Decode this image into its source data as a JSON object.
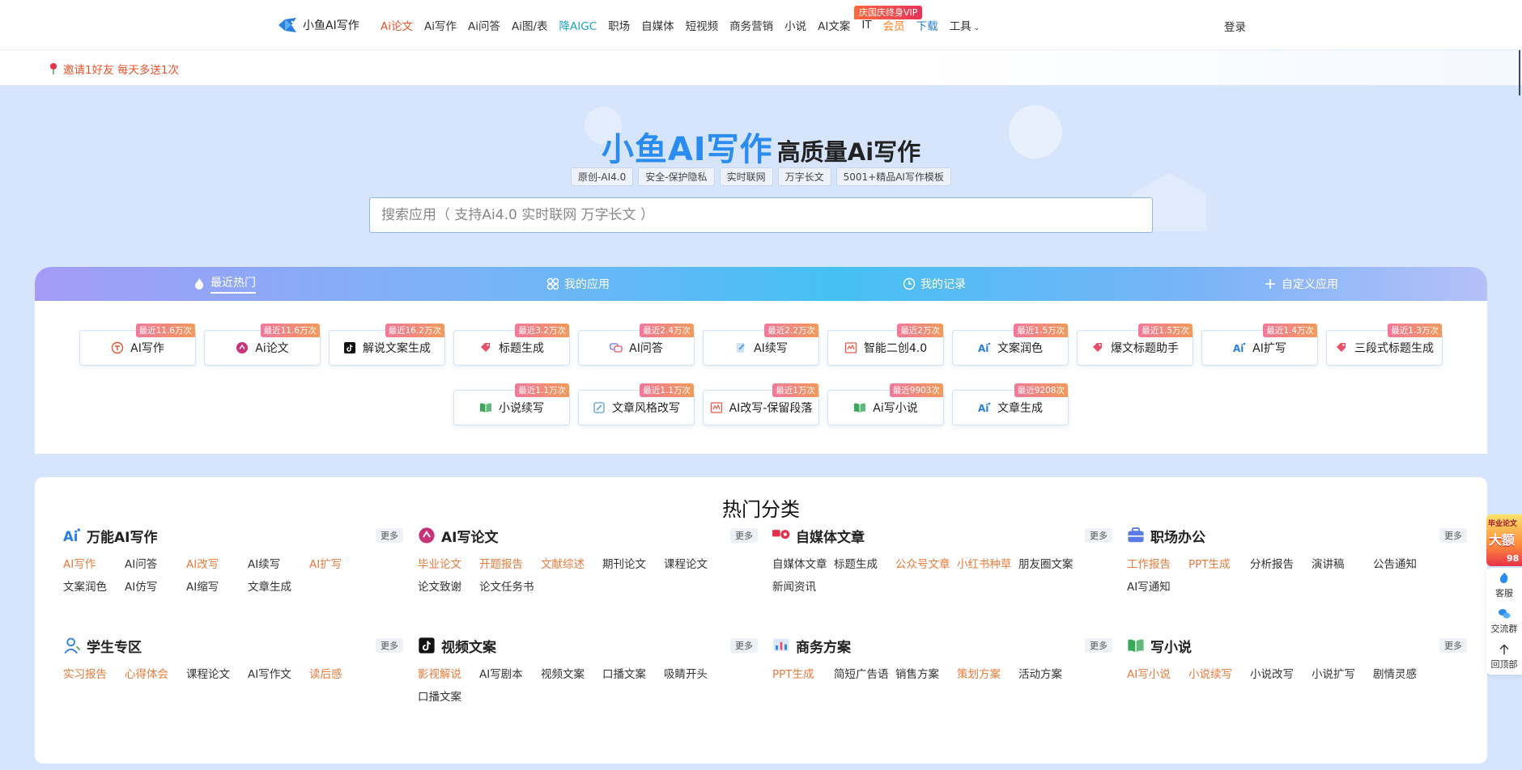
{
  "nav": {
    "brand": "小鱼AI写作",
    "items": [
      {
        "label": "Ai论文",
        "style": "active"
      },
      {
        "label": "Ai写作",
        "style": ""
      },
      {
        "label": "Ai问答",
        "style": ""
      },
      {
        "label": "Ai图/表",
        "style": ""
      },
      {
        "label": "降AIGC",
        "style": "teal"
      },
      {
        "label": "职场",
        "style": ""
      },
      {
        "label": "自媒体",
        "style": ""
      },
      {
        "label": "短视频",
        "style": ""
      },
      {
        "label": "商务营销",
        "style": ""
      },
      {
        "label": "小说",
        "style": ""
      },
      {
        "label": "AI文案",
        "style": ""
      },
      {
        "label": "IT",
        "style": ""
      },
      {
        "label": "会员",
        "style": "orange"
      },
      {
        "label": "下载",
        "style": "blue"
      },
      {
        "label": "工具",
        "style": ""
      }
    ],
    "vip_badge": "庆国庆终身VIP",
    "login": "登录"
  },
  "invite": {
    "text": "邀请1好友 每天多送1次"
  },
  "hero": {
    "brand": "小鱼AI写作",
    "subtitle": "高质量Ai写作",
    "tags": [
      "原创-AI4.0",
      "安全-保护隐私",
      "实时联网",
      "万字长文",
      "5001+精品AI写作模板"
    ],
    "search_placeholder": "搜索应用（ 支持Ai4.0 实时联网 万字长文 ）"
  },
  "tabs": [
    {
      "label": "最近热门",
      "icon": "flame-icon",
      "active": true
    },
    {
      "label": "我的应用",
      "icon": "grid-icon",
      "active": false
    },
    {
      "label": "我的记录",
      "icon": "clock-icon",
      "active": false
    },
    {
      "label": "自定义应用",
      "icon": "plus-icon",
      "active": false
    }
  ],
  "apps": [
    {
      "label": "AI写作",
      "badge": "最近11.6万次",
      "icon": "writing-icon",
      "color": "#e8532a"
    },
    {
      "label": "Ai论文",
      "badge": "最近11.6万次",
      "icon": "paper-icon",
      "color": "#c8327a"
    },
    {
      "label": "解说文案生成",
      "badge": "最近16.2万次",
      "icon": "tiktok-icon",
      "color": "#111111"
    },
    {
      "label": "标题生成",
      "badge": "最近3.2万次",
      "icon": "tag-icon",
      "color": "#e8506a"
    },
    {
      "label": "AI问答",
      "badge": "最近2.4万次",
      "icon": "qa-icon",
      "color": "#7a6af0"
    },
    {
      "label": "AI续写",
      "badge": "最近2.2万次",
      "icon": "pen-icon",
      "color": "#58a0d8"
    },
    {
      "label": "智能二创4.0",
      "badge": "最近2万次",
      "icon": "rewrite-icon",
      "color": "#e85a4a"
    },
    {
      "label": "文案润色",
      "badge": "最近1.5万次",
      "icon": "ai-icon",
      "color": "#2a7de1"
    },
    {
      "label": "爆文标题助手",
      "badge": "最近1.5万次",
      "icon": "tag-icon",
      "color": "#e8506a"
    },
    {
      "label": "AI扩写",
      "badge": "最近1.4万次",
      "icon": "ai-icon",
      "color": "#2a7de1"
    },
    {
      "label": "三段式标题生成",
      "badge": "最近1.3万次",
      "icon": "tag-icon",
      "color": "#e8506a"
    },
    {
      "label": "小说续写",
      "badge": "最近1.1万次",
      "icon": "book-icon",
      "color": "#3aa85a"
    },
    {
      "label": "文章风格改写",
      "badge": "最近1.1万次",
      "icon": "edit-icon",
      "color": "#58a0d8"
    },
    {
      "label": "AI改写-保留段落",
      "badge": "最近1万次",
      "icon": "rewrite-icon",
      "color": "#e85a4a"
    },
    {
      "label": "Ai写小说",
      "badge": "最近9903次",
      "icon": "book-icon",
      "color": "#3aa85a"
    },
    {
      "label": "文章生成",
      "badge": "最近9208次",
      "icon": "ai-icon",
      "color": "#2a7de1"
    }
  ],
  "categories_title": "热门分类",
  "more_label": "更多",
  "categories": [
    {
      "name": "万能AI写作",
      "icon": "ai-icon",
      "links": [
        {
          "t": "AI写作",
          "hot": true
        },
        {
          "t": "AI问答",
          "hot": false
        },
        {
          "t": "AI改写",
          "hot": true
        },
        {
          "t": "AI续写",
          "hot": false
        },
        {
          "t": "AI扩写",
          "hot": true
        },
        {
          "t": "文案润色",
          "hot": false
        },
        {
          "t": "AI仿写",
          "hot": false
        },
        {
          "t": "AI缩写",
          "hot": false
        },
        {
          "t": "文章生成",
          "hot": false
        }
      ]
    },
    {
      "name": "AI写论文",
      "icon": "paper-icon",
      "links": [
        {
          "t": "毕业论文",
          "hot": true
        },
        {
          "t": "开题报告",
          "hot": true
        },
        {
          "t": "文献综述",
          "hot": true
        },
        {
          "t": "期刊论文",
          "hot": false
        },
        {
          "t": "课程论文",
          "hot": false
        },
        {
          "t": "论文致谢",
          "hot": false
        },
        {
          "t": "论文任务书",
          "hot": false
        }
      ]
    },
    {
      "name": "自媒体文章",
      "icon": "media-icon",
      "links": [
        {
          "t": "自媒体文章",
          "hot": false
        },
        {
          "t": "标题生成",
          "hot": false
        },
        {
          "t": "公众号文章",
          "hot": true
        },
        {
          "t": "小红书种草",
          "hot": true
        },
        {
          "t": "朋友圈文案",
          "hot": false
        },
        {
          "t": "新闻资讯",
          "hot": false
        }
      ]
    },
    {
      "name": "职场办公",
      "icon": "briefcase-icon",
      "links": [
        {
          "t": "工作报告",
          "hot": true
        },
        {
          "t": "PPT生成",
          "hot": true
        },
        {
          "t": "分析报告",
          "hot": false
        },
        {
          "t": "演讲稿",
          "hot": false
        },
        {
          "t": "公告通知",
          "hot": false
        },
        {
          "t": "AI写通知",
          "hot": false
        }
      ]
    },
    {
      "name": "学生专区",
      "icon": "student-icon",
      "links": [
        {
          "t": "实习报告",
          "hot": true
        },
        {
          "t": "心得体会",
          "hot": true
        },
        {
          "t": "课程论文",
          "hot": false
        },
        {
          "t": "AI写作文",
          "hot": false
        },
        {
          "t": "读后感",
          "hot": true
        }
      ]
    },
    {
      "name": "视频文案",
      "icon": "tiktok-icon",
      "links": [
        {
          "t": "影视解说",
          "hot": true
        },
        {
          "t": "AI写剧本",
          "hot": false
        },
        {
          "t": "视频文案",
          "hot": false
        },
        {
          "t": "口播文案",
          "hot": false
        },
        {
          "t": "吸睛开头",
          "hot": false
        },
        {
          "t": "口播文案",
          "hot": false
        }
      ]
    },
    {
      "name": "商务方案",
      "icon": "chart-icon",
      "links": [
        {
          "t": "PPT生成",
          "hot": true
        },
        {
          "t": "简短广告语",
          "hot": false
        },
        {
          "t": "销售方案",
          "hot": false
        },
        {
          "t": "策划方案",
          "hot": true
        },
        {
          "t": "活动方案",
          "hot": false
        }
      ]
    },
    {
      "name": "写小说",
      "icon": "book-icon",
      "links": [
        {
          "t": "AI写小说",
          "hot": true
        },
        {
          "t": "小说续写",
          "hot": true
        },
        {
          "t": "小说改写",
          "hot": false
        },
        {
          "t": "小说扩写",
          "hot": false
        },
        {
          "t": "剧情灵感",
          "hot": false
        }
      ]
    }
  ],
  "float": {
    "promo_top": "毕业论文",
    "promo_mid": "大额",
    "promo_num": "98",
    "items": [
      {
        "label": "客服",
        "icon": "support-icon"
      },
      {
        "label": "交流群",
        "icon": "chat-icon"
      },
      {
        "label": "回顶部",
        "icon": "arrow-up-icon"
      }
    ]
  },
  "colors": {
    "accent": "#2a8cf0",
    "hot": "#e87a3a",
    "nav_active": "#e8532a"
  }
}
